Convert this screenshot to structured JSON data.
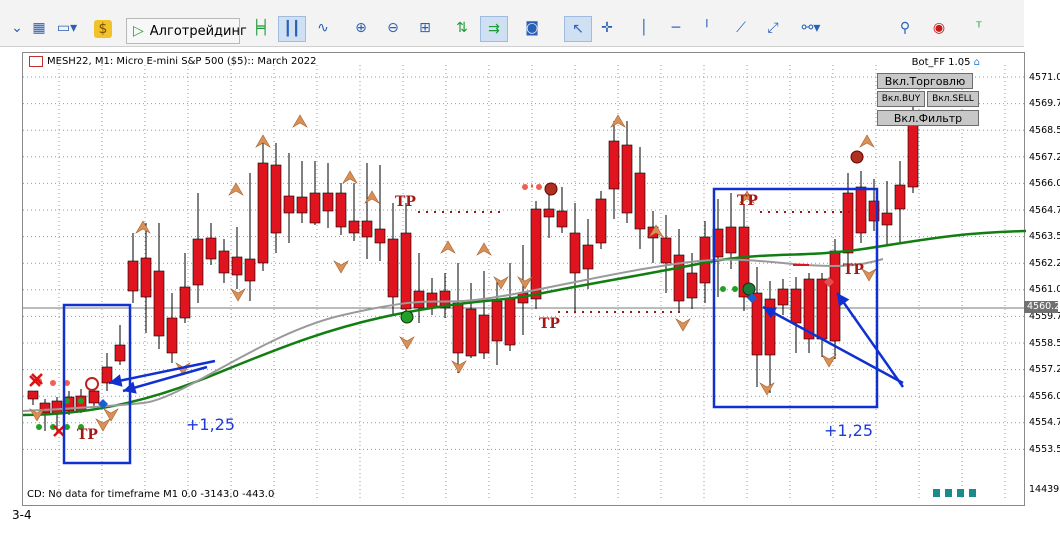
{
  "toolbar": {
    "algo_label": "Алготрейдинг",
    "icons": [
      "chevron-down-icon",
      "chart-type-icon",
      "coins-icon",
      "play-icon",
      "bar-chart-icon",
      "candles-icon",
      "line-chart-icon",
      "zoom-in-icon",
      "zoom-out-icon",
      "grid-icon",
      "indicator-icon",
      "expert-icon",
      "screenshot-icon",
      "cursor-icon",
      "crosshair-icon",
      "vertical-line-icon",
      "horizontal-line-icon",
      "trend-line-icon",
      "channel-icon",
      "shapes-icon",
      "search-icon",
      "account-icon",
      "signal-icon"
    ]
  },
  "chart": {
    "symbol_title": "MESH22, M1:  Micro E-mini S&P 500 ($5):: March 2022",
    "status_text": "CD: No data for timeframe M1 0.0 -3143.0 -443.0",
    "bot_label": "Bot_FF 1.05",
    "panel_buttons": {
      "trade": "Вкл.Торговлю",
      "buy": "Вкл.BUY",
      "sell": "Вкл.SELL",
      "filter": "Вкл.Фильтр"
    },
    "annotations": {
      "tp": "TP",
      "gain_left": "+1,25",
      "gain_right": "+1,25"
    }
  },
  "price_scale": {
    "labels": [
      "4571.0",
      "4569.7",
      "4568.5",
      "4567.2",
      "4566.0",
      "4564.7",
      "4563.5",
      "4562.2",
      "4561.0",
      "4559.7",
      "4558.5",
      "4557.2",
      "4556.0",
      "4554.7",
      "4553.5"
    ],
    "current": "4560.2",
    "volume_value": "14439"
  },
  "caption": "3-4",
  "colors": {
    "bull": "#22a024",
    "bear": "#e0141e",
    "ma_green": "#127e12",
    "ma_gray": "#9a9a9a",
    "box": "#1030d0",
    "tp_red": "#a01818",
    "arrow_orange": "#d99055"
  }
}
